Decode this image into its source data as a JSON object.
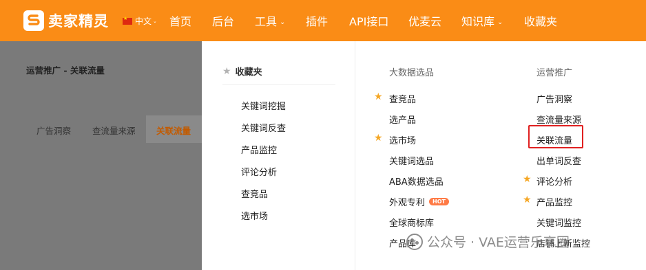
{
  "brand": {
    "name": "卖家精灵"
  },
  "language": {
    "label": "中文",
    "flag_icon": "china-flag-icon"
  },
  "nav": {
    "items": [
      {
        "label": "首页"
      },
      {
        "label": "后台"
      },
      {
        "label": "工具",
        "has_dropdown": true
      },
      {
        "label": "插件"
      },
      {
        "label": "API接口"
      },
      {
        "label": "优麦云"
      },
      {
        "label": "知识库",
        "has_dropdown": true
      },
      {
        "label": "收藏夹"
      }
    ]
  },
  "page": {
    "breadcrumb": "运营推广 - 关联流量",
    "subtabs": [
      {
        "label": "广告洞察",
        "active": false
      },
      {
        "label": "查流量来源",
        "active": false
      },
      {
        "label": "关联流量",
        "active": true
      }
    ]
  },
  "dropdown": {
    "favorites": {
      "title": "收藏夹",
      "items": [
        "关键词挖掘",
        "关键词反查",
        "产品监控",
        "评论分析",
        "查竞品",
        "选市场"
      ]
    },
    "bigdata": {
      "title": "大数据选品",
      "items": [
        {
          "label": "查竞品",
          "starred": true
        },
        {
          "label": "选产品",
          "starred": false
        },
        {
          "label": "选市场",
          "starred": true
        },
        {
          "label": "关键词选品",
          "starred": false
        },
        {
          "label": "ABA数据选品",
          "starred": false
        },
        {
          "label": "外观专利",
          "starred": false,
          "badge": "HOT"
        },
        {
          "label": "全球商标库",
          "starred": false
        },
        {
          "label": "产品库",
          "starred": false
        }
      ]
    },
    "operations": {
      "title": "运营推广",
      "items": [
        {
          "label": "广告洞察",
          "starred": false
        },
        {
          "label": "查流量来源",
          "starred": false
        },
        {
          "label": "关联流量",
          "starred": false,
          "highlighted": true
        },
        {
          "label": "出单词反查",
          "starred": false
        },
        {
          "label": "评论分析",
          "starred": true
        },
        {
          "label": "产品监控",
          "starred": true
        },
        {
          "label": "关键词监控",
          "starred": false
        },
        {
          "label": "店铺上新监控",
          "starred": false
        }
      ]
    }
  },
  "watermark": {
    "text": "公众号 · VAE运营乐享圈"
  },
  "colors": {
    "brand_orange": "#fa8c16",
    "star": "#f5a623",
    "highlight_border": "#e02020",
    "hot_badge": "#ff7a45"
  }
}
